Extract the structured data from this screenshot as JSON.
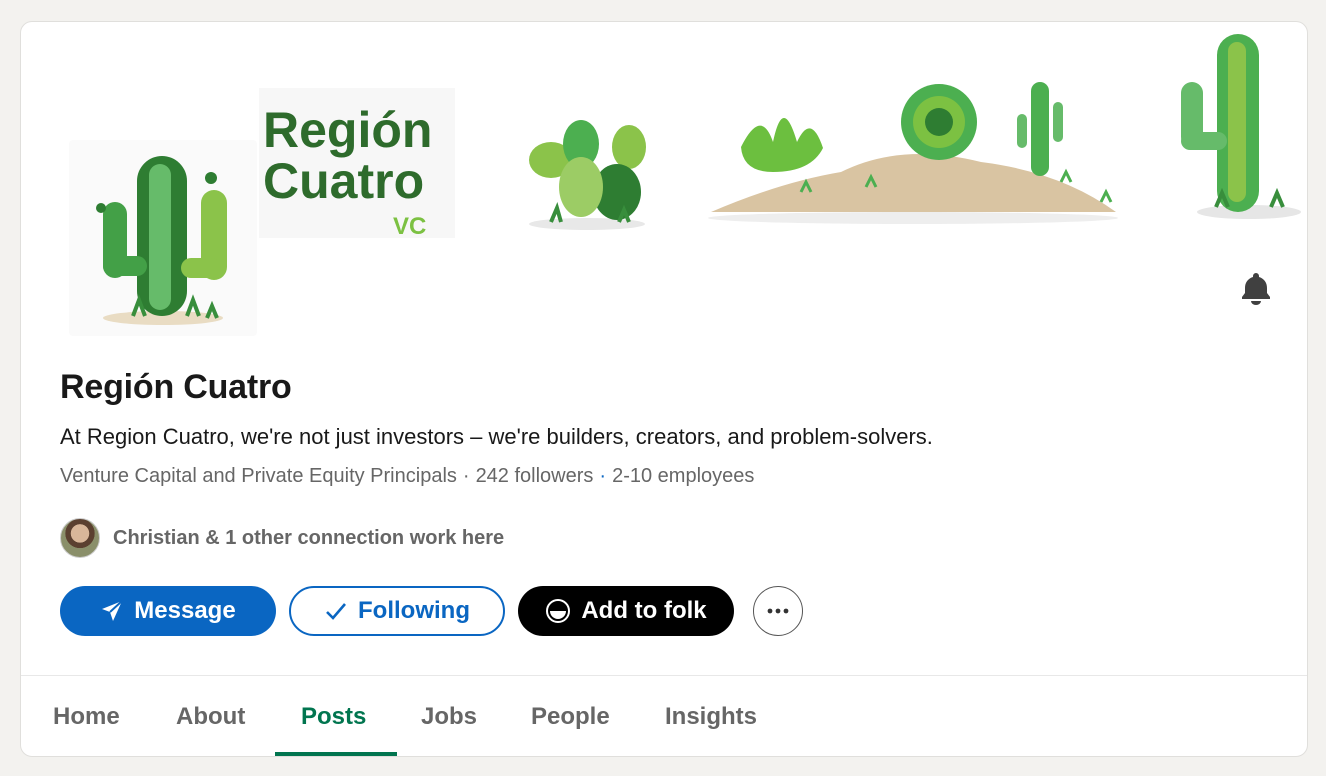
{
  "banner": {
    "brand_line1": "Región",
    "brand_line2": "Cuatro",
    "brand_sub": "VC"
  },
  "company": {
    "name": "Región Cuatro",
    "tagline": "At Region Cuatro, we're not just investors – we're builders, creators, and problem-solvers.",
    "industry": "Venture Capital and Private Equity Principals",
    "followers": "242 followers",
    "employees": "2-10 employees"
  },
  "connections": {
    "text": "Christian & 1 other connection work here"
  },
  "actions": {
    "message": "Message",
    "following": "Following",
    "add_to_folk": "Add to folk"
  },
  "tabs": [
    {
      "label": "Home"
    },
    {
      "label": "About"
    },
    {
      "label": "Posts"
    },
    {
      "label": "Jobs"
    },
    {
      "label": "People"
    },
    {
      "label": "Insights"
    }
  ],
  "active_tab": "Posts",
  "colors": {
    "linkedin_blue": "#0a66c2",
    "active_tab_green": "#01754f",
    "cactus_green": "#3f9a3a",
    "brand_green": "#2e6b2c"
  },
  "icons": {
    "bell": "bell-icon",
    "message": "send-icon",
    "following": "checkmark-icon",
    "folk": "folk-logo-icon",
    "more": "more-horizontal-icon"
  }
}
